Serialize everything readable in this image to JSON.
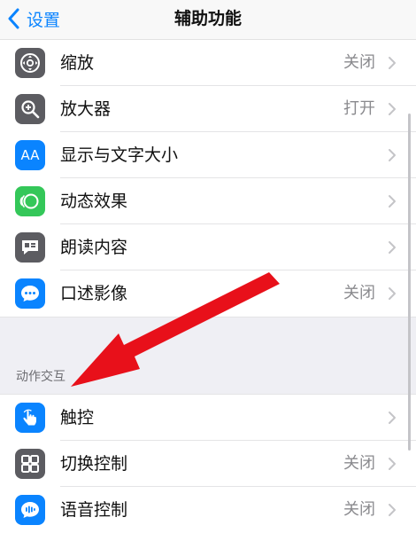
{
  "nav": {
    "back_label": "设置",
    "title": "辅助功能"
  },
  "colors": {
    "accent": "#0a84ff",
    "gray_icon": "#5c5c61",
    "green_icon": "#34c759",
    "arrow": "#e8101a"
  },
  "items": [
    {
      "label": "缩放",
      "value": "关闭",
      "icon": "zoom-icon"
    },
    {
      "label": "放大器",
      "value": "打开",
      "icon": "magnifier-icon"
    },
    {
      "label": "显示与文字大小",
      "value": "",
      "icon": "text-size-icon",
      "icon_text": "AA"
    },
    {
      "label": "动态效果",
      "value": "",
      "icon": "motion-icon"
    },
    {
      "label": "朗读内容",
      "value": "",
      "icon": "spoken-content-icon"
    },
    {
      "label": "口述影像",
      "value": "关闭",
      "icon": "audio-description-icon"
    }
  ],
  "section_header": "动作交互",
  "items2": [
    {
      "label": "触控",
      "value": "",
      "icon": "touch-icon"
    },
    {
      "label": "切换控制",
      "value": "关闭",
      "icon": "switch-control-icon"
    },
    {
      "label": "语音控制",
      "value": "关闭",
      "icon": "voice-control-icon"
    }
  ]
}
